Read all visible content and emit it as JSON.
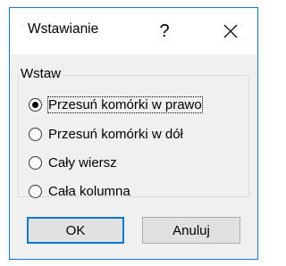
{
  "dialog": {
    "title": "Wstawianie",
    "help_label": "?",
    "close_icon": "close-x-icon"
  },
  "group": {
    "label": "Wstaw",
    "options": [
      {
        "label": "Przesuń komórki w prawo",
        "checked": true
      },
      {
        "label": "Przesuń komórki w dół",
        "checked": false
      },
      {
        "label": "Cały wiersz",
        "checked": false
      },
      {
        "label": "Cała kolumna",
        "checked": false
      }
    ]
  },
  "buttons": {
    "ok_label": "OK",
    "cancel_label": "Anuluj"
  },
  "colors": {
    "accent_border": "#0a78d4",
    "client_bg": "#f0f0f0",
    "button_bg": "#e1e1e1",
    "default_button_border": "#0078d7"
  }
}
